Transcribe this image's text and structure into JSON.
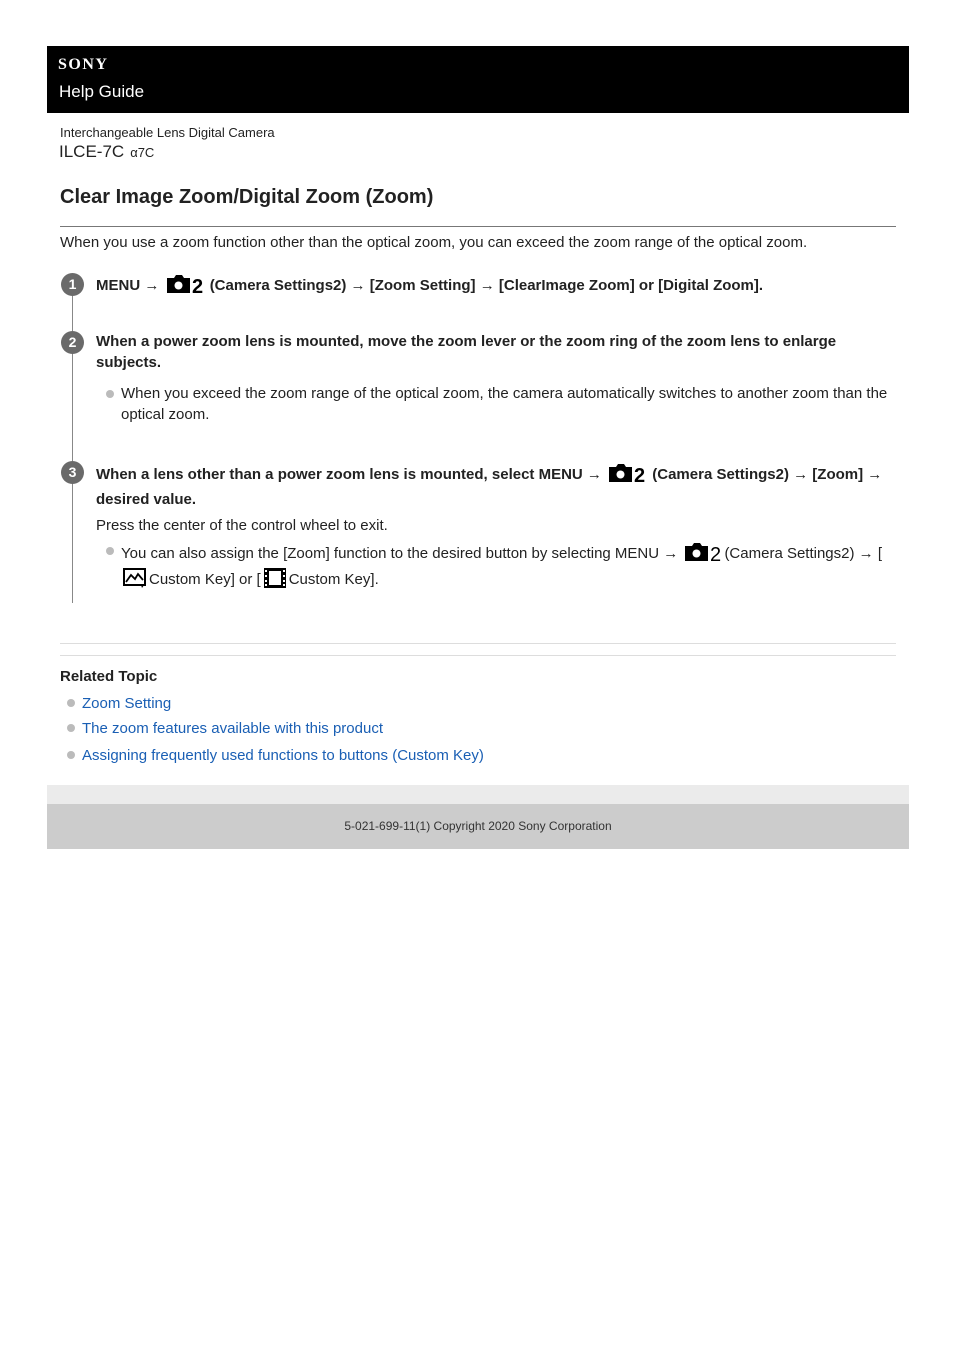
{
  "header": {
    "brand": "SONY",
    "subtitle": "Help Guide"
  },
  "product": {
    "type": "Interchangeable Lens Digital Camera",
    "model": "ILCE-7C",
    "alias": "α7C"
  },
  "page": {
    "title": "Clear Image Zoom/Digital Zoom (Zoom)",
    "intro": "When you use a zoom function other than the optical zoom, you can exceed the zoom range of the optical zoom."
  },
  "steps": [
    {
      "number": "1",
      "text_before_icon": "MENU →",
      "icon": "camera-settings2-icon",
      "text_after_icon": "(Camera Settings2) → [Zoom Setting] → [ClearImage Zoom] or [Digital Zoom]."
    },
    {
      "number": "2",
      "text": "When a power zoom lens is mounted, move the zoom lever or the zoom ring of the zoom lens to enlarge subjects.",
      "bullets": [
        "When you exceed the zoom range of the optical zoom, the camera automatically switches to another zoom than the optical zoom."
      ]
    },
    {
      "number": "3",
      "text_before_icon": "When a lens other than a power zoom lens is mounted, select MENU →",
      "icon": "camera-settings2-icon",
      "text_after_icon": "(Camera Settings2) → [Zoom] → desired value.",
      "body": "Press the center of the control wheel to exit.",
      "bullet": {
        "part1": "You can also assign the [Zoom] function to the desired button by selecting MENU →",
        "part2": "(Camera Settings2) → [",
        "part3": "Custom Key] or [",
        "part4": "Custom Key].",
        "icons": [
          "still-image-icon",
          "movie-icon"
        ]
      }
    }
  ],
  "related": {
    "title": "Related Topic",
    "links": [
      "Zoom Setting",
      "The zoom features available with this product",
      "Assigning frequently used functions to buttons (Custom Key)"
    ]
  },
  "footer": {
    "copyright": "5-021-699-11(1) Copyright 2020 Sony Corporation"
  },
  "colors": {
    "link": "#1a5fb4",
    "header_bg": "#000000",
    "footer_bg": "#cccccc"
  }
}
